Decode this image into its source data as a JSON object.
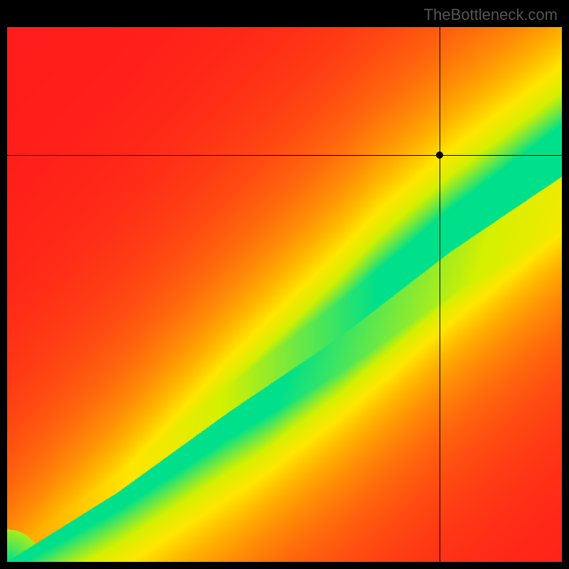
{
  "watermark": "TheBottleneck.com",
  "chart_data": {
    "type": "heatmap",
    "title": "",
    "xlabel": "",
    "ylabel": "",
    "xlim": [
      0,
      100
    ],
    "ylim": [
      0,
      100
    ],
    "crosshair": {
      "x": 78,
      "y": 76
    },
    "optimal_band": {
      "description": "Green optimal-match diagonal band widening toward top-right; red in far-off corners; yellow transition.",
      "center_curve": [
        {
          "x": 0,
          "y": 0
        },
        {
          "x": 20,
          "y": 13
        },
        {
          "x": 40,
          "y": 28
        },
        {
          "x": 60,
          "y": 42
        },
        {
          "x": 80,
          "y": 58
        },
        {
          "x": 100,
          "y": 72
        }
      ],
      "band_half_width_pct": 6
    },
    "colorscale": [
      {
        "stop": 0.0,
        "color": "#ff1a1a"
      },
      {
        "stop": 0.45,
        "color": "#ffb000"
      },
      {
        "stop": 0.6,
        "color": "#ffe600"
      },
      {
        "stop": 0.75,
        "color": "#d4f000"
      },
      {
        "stop": 1.0,
        "color": "#00e08a"
      }
    ]
  }
}
